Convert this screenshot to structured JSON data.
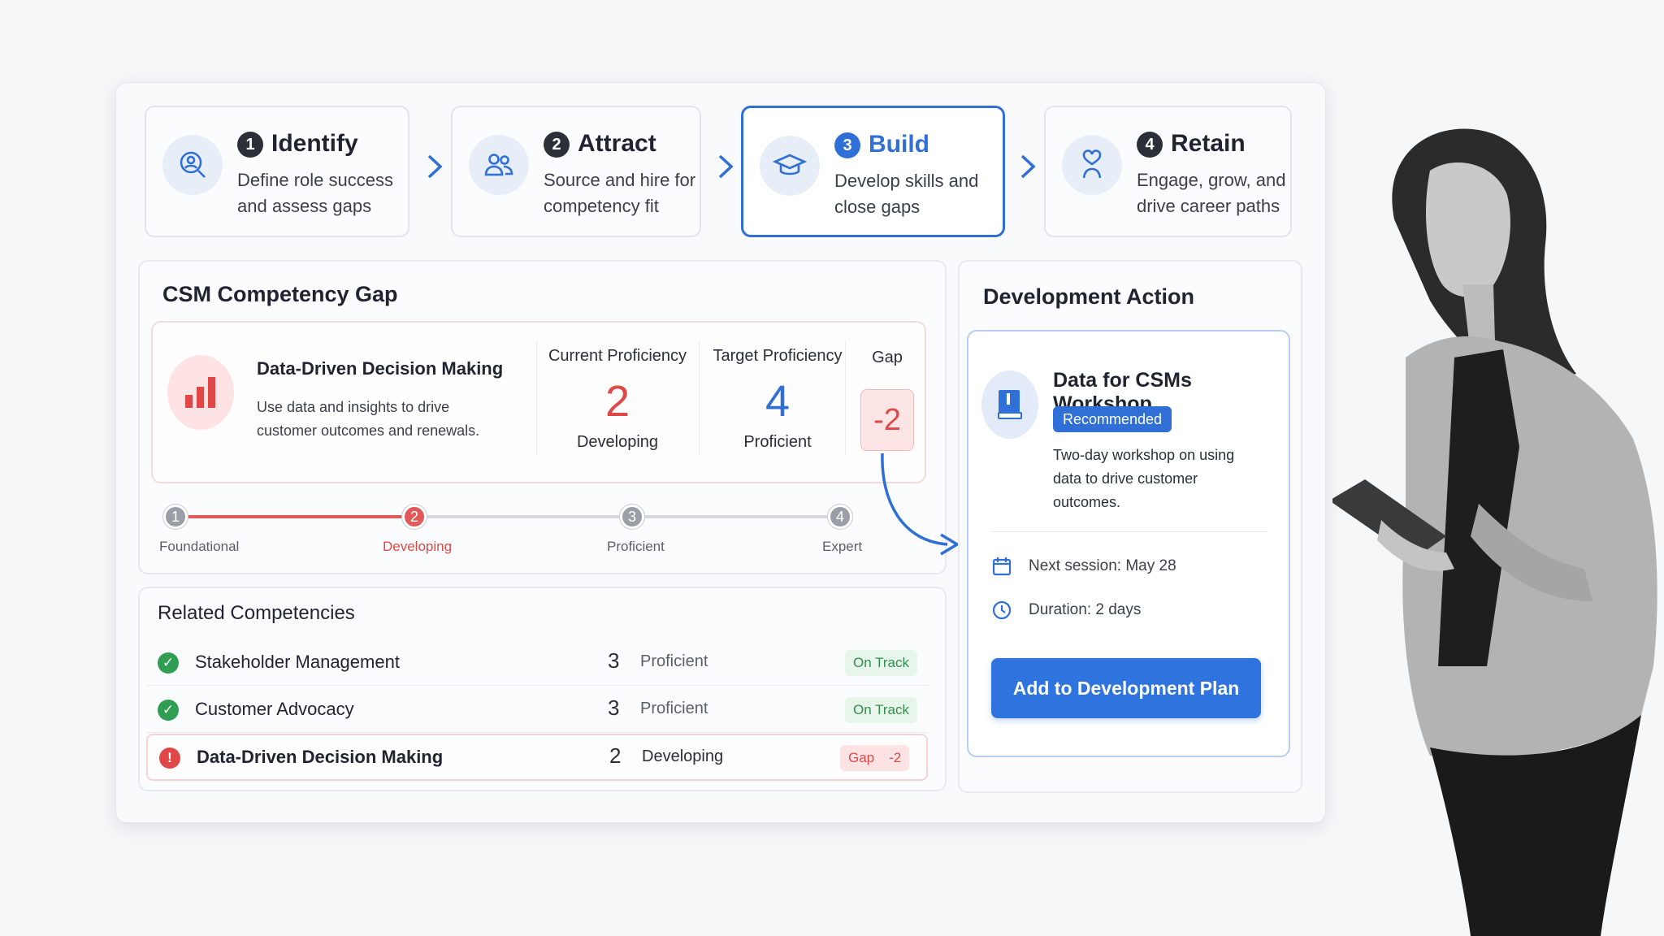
{
  "steps": [
    {
      "num": "1",
      "title": "Identify",
      "desc": "Define role success and assess gaps",
      "icon": "search-user-icon"
    },
    {
      "num": "2",
      "title": "Attract",
      "desc": "Source and hire for competency fit",
      "icon": "users-icon"
    },
    {
      "num": "3",
      "title": "Build",
      "desc": "Develop skills and close gaps",
      "icon": "graduation-cap-icon"
    },
    {
      "num": "4",
      "title": "Retain",
      "desc": "Engage, grow, and drive career paths",
      "icon": "heart-person-icon"
    }
  ],
  "gap_panel": {
    "title": "CSM Competency Gap",
    "competency": "Data-Driven Decision Making",
    "description": "Use data and insights to drive customer outcomes and renewals.",
    "current_head": "Current Proficiency",
    "current_value": "2",
    "current_label": "Developing",
    "target_head": "Target Proficiency",
    "target_value": "4",
    "target_label": "Proficient",
    "gap_head": "Gap",
    "gap_value": "-2",
    "scale": [
      {
        "num": "1",
        "label": "Foundational"
      },
      {
        "num": "2",
        "label": "Developing"
      },
      {
        "num": "3",
        "label": "Proficient"
      },
      {
        "num": "4",
        "label": "Expert"
      }
    ]
  },
  "related": {
    "title": "Related Competencies",
    "rows": [
      {
        "name": "Stakeholder Management",
        "level": "3",
        "label": "Proficient",
        "status": "On Track",
        "gap": ""
      },
      {
        "name": "Customer Advocacy",
        "level": "3",
        "label": "Proficient",
        "status": "On Track",
        "gap": ""
      },
      {
        "name": "Data-Driven Decision Making",
        "level": "2",
        "label": "Developing",
        "status": "Gap",
        "gap": "-2"
      }
    ]
  },
  "action": {
    "title": "Development Action",
    "workshop": "Data for CSMs Workshop",
    "tag": "Recommended",
    "desc": "Two-day workshop on using data to drive customer outcomes.",
    "next_session": "Next session: May 28",
    "duration": "Duration: 2 days",
    "cta": "Add to Development Plan"
  },
  "colors": {
    "accent": "#2f6fd6",
    "danger": "#e04848",
    "success": "#2f8f4e"
  }
}
